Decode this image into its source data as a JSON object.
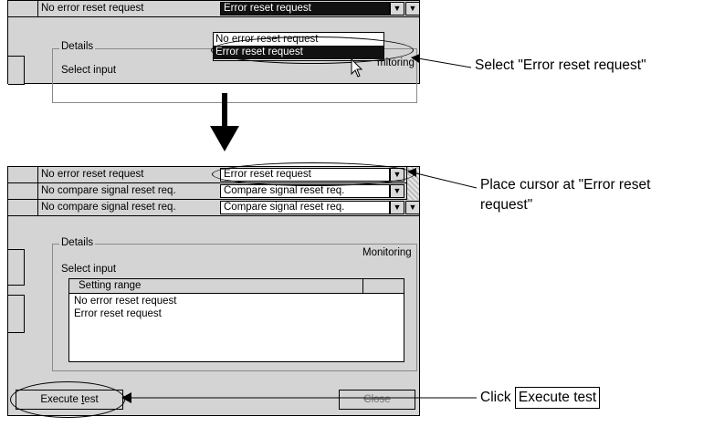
{
  "top": {
    "row_current": "No error reset request",
    "combo_value": "Error reset request",
    "dropdown_options": [
      "No error reset request",
      "Error reset request"
    ],
    "details_label": "Details",
    "select_input_label": "Select input",
    "monitoring_partial": "mitoring"
  },
  "bottom": {
    "rows": [
      {
        "current": "No error reset request",
        "value": "Error reset request"
      },
      {
        "current": "No compare signal reset req.",
        "value": "Compare signal reset req."
      },
      {
        "current": "No compare signal reset req.",
        "value": "Compare signal reset req."
      }
    ],
    "details_label": "Details",
    "monitoring_label": "Monitoring",
    "select_input_label": "Select input",
    "table_header": "Setting range",
    "list_items": [
      "No error reset request",
      "Error reset request"
    ],
    "execute_prefix": "Execute ",
    "execute_mnemonic": "t",
    "execute_suffix": "est",
    "close_label": "Close"
  },
  "callouts": {
    "select": "Select \"Error reset request\"",
    "place_line1": "Place cursor at \"Error reset",
    "place_line2": "request\"",
    "click_prefix": "Click",
    "click_boxed": "Execute test"
  }
}
